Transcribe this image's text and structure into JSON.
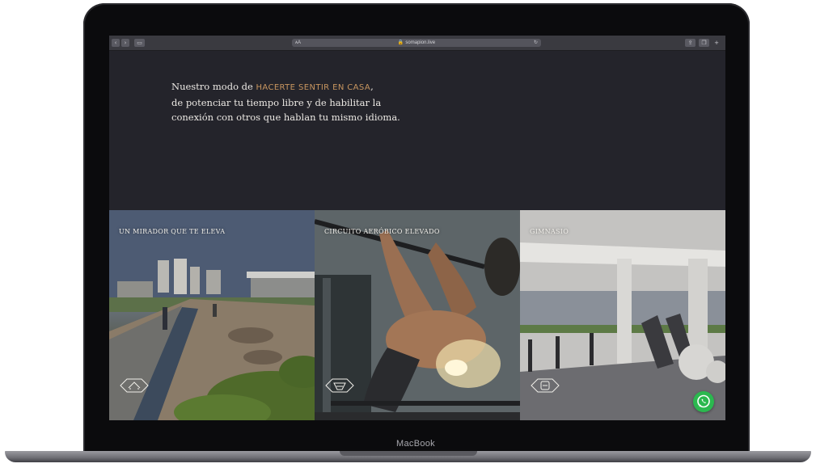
{
  "browser": {
    "url": "somapion.live",
    "reader_glyph": "ᴀA",
    "reload_glyph": "↻",
    "lock_glyph": "🔒"
  },
  "intro": {
    "lead": "Nuestro modo de ",
    "highlight": "HACERTE SENTIR EN CASA",
    "after_highlight": ",",
    "line2": "de potenciar tu tiempo libre y de habilitar la",
    "line3": "conexión con otros que hablan tu mismo idioma."
  },
  "features": [
    {
      "title": "UN MIRADOR QUE TE ELEVA",
      "icon": "rooftop-icon"
    },
    {
      "title": "CIRCUITO AERÓBICO ELEVADO",
      "icon": "track-icon"
    },
    {
      "title": "GIMNASIO",
      "icon": "gym-icon"
    }
  ],
  "whatsapp": {
    "icon": "whatsapp-icon"
  },
  "device": {
    "brand": "MacBook"
  },
  "colors": {
    "accent": "#c7955f",
    "background": "#24242b",
    "whatsapp": "#2bb84f"
  }
}
